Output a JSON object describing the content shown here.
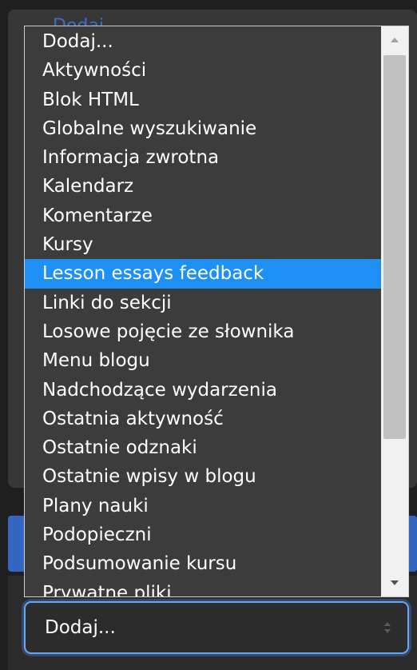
{
  "background_panel": {
    "title": "Dodaj..."
  },
  "dropdown": {
    "options": [
      {
        "label": "Dodaj..."
      },
      {
        "label": "Aktywności"
      },
      {
        "label": "Blok HTML"
      },
      {
        "label": "Globalne wyszukiwanie"
      },
      {
        "label": "Informacja zwrotna"
      },
      {
        "label": "Kalendarz"
      },
      {
        "label": "Komentarze"
      },
      {
        "label": "Kursy"
      },
      {
        "label": "Lesson essays feedback"
      },
      {
        "label": "Linki do sekcji"
      },
      {
        "label": "Losowe pojęcie ze słownika"
      },
      {
        "label": "Menu blogu"
      },
      {
        "label": "Nadchodzące wydarzenia"
      },
      {
        "label": "Ostatnia aktywność"
      },
      {
        "label": "Ostatnie odznaki"
      },
      {
        "label": "Ostatnie wpisy w blogu"
      },
      {
        "label": "Plany nauki"
      },
      {
        "label": "Podopieczni"
      },
      {
        "label": "Podsumowanie kursu"
      },
      {
        "label": "Prywatne pliki"
      }
    ],
    "highlighted_option": "Lesson essays feedback",
    "scroll_up_icon": "triangle-up-icon",
    "scroll_down_icon": "triangle-down-icon"
  },
  "select": {
    "value": "Dodaj...",
    "caret_icon": "updown-caret-icon"
  },
  "colors": {
    "highlight": "#1e8ff5",
    "list_bg": "#3c3c3c",
    "focus_border": "#6aa5f2",
    "blue_strip": "#3266c0"
  }
}
